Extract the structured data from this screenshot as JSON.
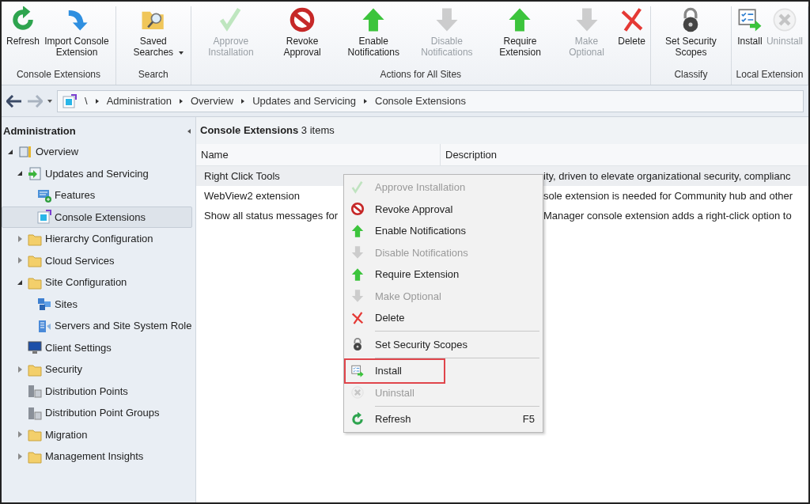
{
  "ribbon": {
    "groups": [
      {
        "label": "Console Extensions",
        "buttons": [
          {
            "label": "Refresh",
            "kind": "refresh",
            "disabled": false
          },
          {
            "label": "Import Console Extension",
            "kind": "import",
            "disabled": false
          }
        ]
      },
      {
        "label": "Search",
        "buttons": [
          {
            "label": "Saved Searches",
            "kind": "search",
            "disabled": false,
            "dropdown": true
          }
        ]
      },
      {
        "label": "Actions for All Sites",
        "buttons": [
          {
            "label": "Approve Installation",
            "kind": "check",
            "disabled": true
          },
          {
            "label": "Revoke Approval",
            "kind": "revoke",
            "disabled": false
          },
          {
            "label": "Enable Notifications",
            "kind": "up",
            "disabled": false
          },
          {
            "label": "Disable Notifications",
            "kind": "down",
            "disabled": true
          },
          {
            "label": "Require Extension",
            "kind": "up",
            "disabled": false
          },
          {
            "label": "Make Optional",
            "kind": "down",
            "disabled": true
          },
          {
            "label": "Delete",
            "kind": "delete",
            "disabled": false
          }
        ]
      },
      {
        "label": "Classify",
        "buttons": [
          {
            "label": "Set Security Scopes",
            "kind": "lock",
            "disabled": false
          }
        ]
      },
      {
        "label": "Local Extension",
        "buttons": [
          {
            "label": "Install",
            "kind": "install",
            "disabled": false
          },
          {
            "label": "Uninstall",
            "kind": "uninstall",
            "disabled": true
          }
        ]
      }
    ]
  },
  "address_bar": {
    "root": "\\",
    "crumbs": [
      "Administration",
      "Overview",
      "Updates and Servicing",
      "Console Extensions"
    ]
  },
  "sidebar": {
    "title": "Administration",
    "items": [
      {
        "label": "Overview",
        "kind": "overview",
        "expanded": true,
        "selected": false,
        "children": [
          {
            "label": "Updates and Servicing",
            "kind": "updates",
            "expanded": true,
            "selected": false,
            "children": [
              {
                "label": "Features",
                "kind": "features",
                "selected": false
              },
              {
                "label": "Console Extensions",
                "kind": "extensions",
                "selected": true
              }
            ]
          },
          {
            "label": "Hierarchy Configuration",
            "kind": "folder",
            "expanded": false,
            "selected": false
          },
          {
            "label": "Cloud Services",
            "kind": "folder",
            "expanded": false,
            "selected": false
          },
          {
            "label": "Site Configuration",
            "kind": "folder",
            "expanded": true,
            "selected": false,
            "children": [
              {
                "label": "Sites",
                "kind": "sites",
                "selected": false
              },
              {
                "label": "Servers and Site System Role",
                "kind": "servers",
                "selected": false
              }
            ]
          },
          {
            "label": "Client Settings",
            "kind": "client",
            "selected": false
          },
          {
            "label": "Security",
            "kind": "folder",
            "expanded": false,
            "selected": false
          },
          {
            "label": "Distribution Points",
            "kind": "dp",
            "selected": false
          },
          {
            "label": "Distribution Point Groups",
            "kind": "dp",
            "selected": false
          },
          {
            "label": "Migration",
            "kind": "folder",
            "expanded": false,
            "selected": false
          },
          {
            "label": "Management Insights",
            "kind": "folder",
            "expanded": false,
            "selected": false
          }
        ]
      }
    ]
  },
  "list": {
    "title": "**Console Extensions** 3 items",
    "columns": [
      "Name",
      "Description"
    ],
    "rows": [
      {
        "name": "Right Click Tools",
        "description": "ity, driven to elevate organizational security, complianc",
        "selected": true
      },
      {
        "name": "WebView2 extension",
        "description": "sole extension is needed for Community hub and other",
        "selected": false
      },
      {
        "name": "Show all status messages for",
        "description": "Manager console extension adds a right-click option to",
        "selected": false
      }
    ]
  },
  "context_menu": {
    "items": [
      {
        "kind": "check",
        "label": "Approve Installation",
        "disabled": true,
        "outlined": false
      },
      {
        "kind": "revoke",
        "label": "Revoke Approval",
        "disabled": false,
        "outlined": false
      },
      {
        "kind": "up",
        "label": "Enable Notifications",
        "disabled": false,
        "outlined": false
      },
      {
        "kind": "down",
        "label": "Disable Notifications",
        "disabled": true,
        "outlined": false
      },
      {
        "kind": "up",
        "label": "Require Extension",
        "disabled": false,
        "outlined": false
      },
      {
        "kind": "down",
        "label": "Make Optional",
        "disabled": true,
        "outlined": false
      },
      {
        "kind": "delete",
        "label": "Delete",
        "disabled": false,
        "outlined": false
      },
      {
        "kind": "separator"
      },
      {
        "kind": "lock",
        "label": "Set Security Scopes",
        "disabled": false,
        "outlined": false
      },
      {
        "kind": "separator"
      },
      {
        "kind": "install",
        "label": "Install",
        "disabled": false,
        "outlined": true
      },
      {
        "kind": "uninstall",
        "label": "Uninstall",
        "disabled": true,
        "outlined": false
      },
      {
        "kind": "separator"
      },
      {
        "kind": "refresh",
        "label": "Refresh",
        "disabled": false,
        "outlined": false,
        "shortcut": "F5"
      }
    ]
  }
}
